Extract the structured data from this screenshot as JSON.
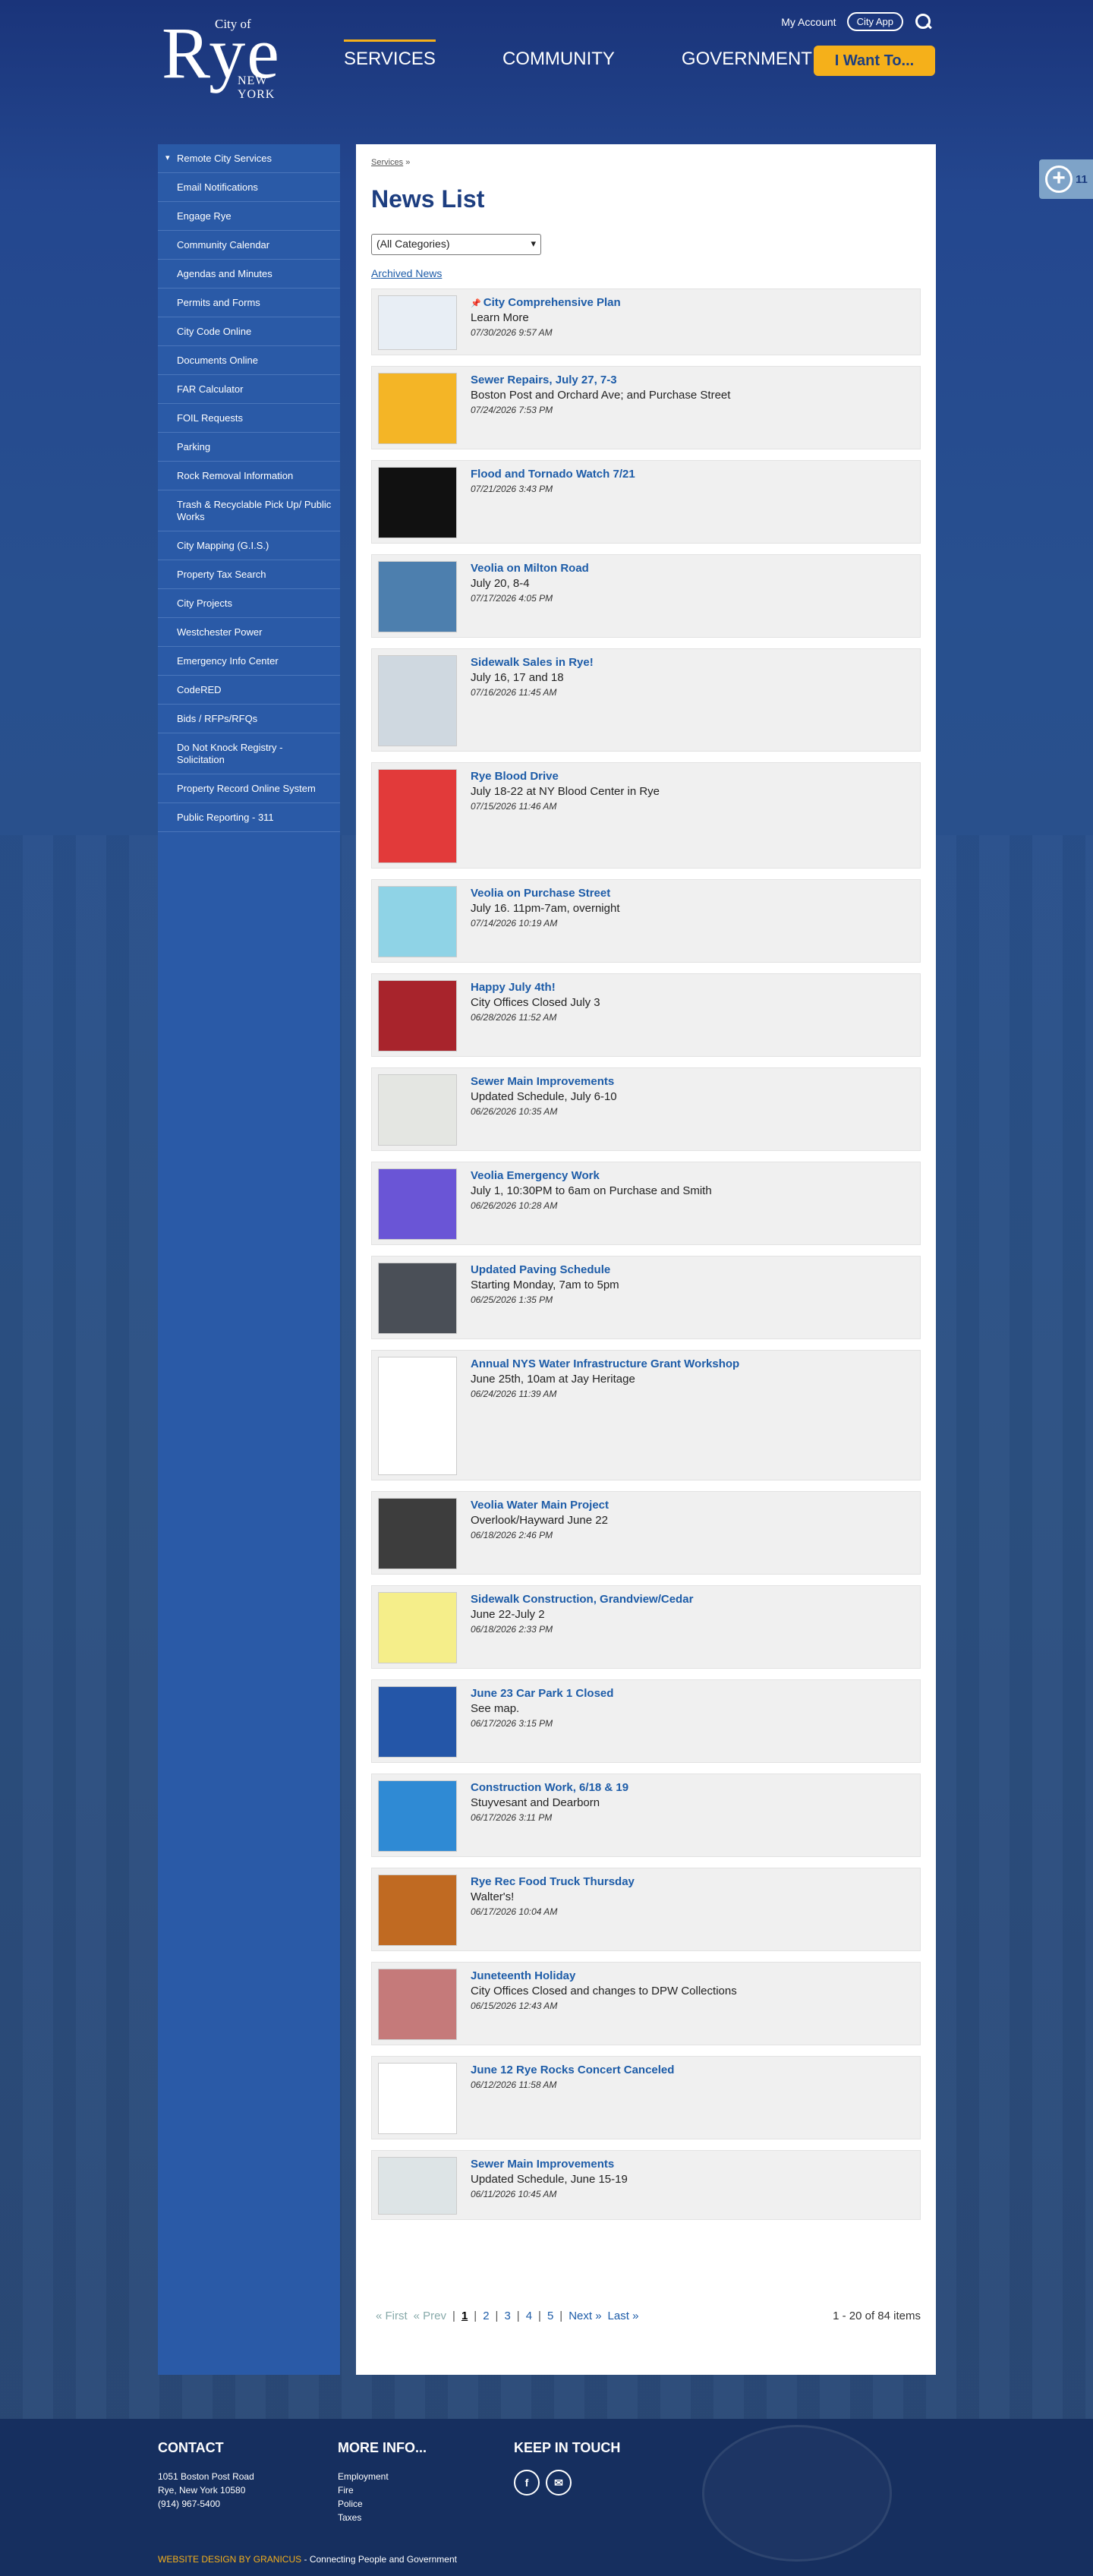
{
  "header": {
    "logo": {
      "city_of": "City of",
      "name": "Rye",
      "state": "NEW YORK"
    },
    "my_account": "My Account",
    "city_app": "City App",
    "nav": [
      "SERVICES",
      "COMMUNITY",
      "GOVERNMENT"
    ],
    "i_want_to": "I Want To...",
    "side_tab_number": "11"
  },
  "sidebar": {
    "items": [
      "Remote City Services",
      "Email Notifications",
      "Engage Rye",
      "Community Calendar",
      "Agendas and Minutes",
      "Permits and Forms",
      "City Code Online",
      "Documents Online",
      "FAR Calculator",
      "FOIL Requests",
      "Parking",
      "Rock Removal Information",
      "Trash & Recyclable Pick Up/ Public Works",
      "City Mapping (G.I.S.)",
      "Property Tax Search",
      "City Projects",
      "Westchester Power",
      "Emergency Info Center",
      "CodeRED",
      "Bids / RFPs/RFQs",
      "Do Not Knock Registry - Solicitation",
      "Property Record Online System",
      "Public Reporting - 311"
    ]
  },
  "main": {
    "breadcrumb": "Services",
    "breadcrumb_sep": "»",
    "title": "News List",
    "category_select": "(All Categories)",
    "archived": "Archived News",
    "news": [
      {
        "title": "City Comprehensive Plan",
        "desc": "Learn More",
        "date": "07/30/2026 9:57 AM",
        "pinned": true,
        "color": "#e8eef5"
      },
      {
        "title": "Sewer Repairs, July 27, 7-3",
        "desc": "Boston Post and Orchard Ave; and Purchase Street",
        "date": "07/24/2026 7:53 PM",
        "color": "#f4b526"
      },
      {
        "title": "Flood and Tornado Watch 7/21",
        "desc": "",
        "date": "07/21/2026 3:43 PM",
        "color": "#111111"
      },
      {
        "title": "Veolia on Milton Road",
        "desc": "July 20, 8-4",
        "date": "07/17/2026 4:05 PM",
        "color": "#4d7fae"
      },
      {
        "title": "Sidewalk Sales in Rye!",
        "desc": "July 16, 17 and 18",
        "date": "07/16/2026 11:45 AM",
        "color": "#cfd8e0"
      },
      {
        "title": "Rye Blood Drive",
        "desc": "July 18-22 at NY Blood Center in Rye",
        "date": "07/15/2026 11:46 AM",
        "color": "#e23a3a"
      },
      {
        "title": "Veolia on Purchase Street",
        "desc": "July 16. 11pm-7am, overnight",
        "date": "07/14/2026 10:19 AM",
        "color": "#8fd3e6"
      },
      {
        "title": "Happy July 4th!",
        "desc": "City Offices Closed July 3",
        "date": "06/28/2026 11:52 AM",
        "color": "#a8242c"
      },
      {
        "title": "Sewer Main Improvements",
        "desc": "Updated Schedule, July 6-10",
        "date": "06/26/2026 10:35 AM",
        "color": "#e4e6e2"
      },
      {
        "title": "Veolia Emergency Work",
        "desc": "July 1, 10:30PM to 6am on Purchase and Smith",
        "date": "06/26/2026 10:28 AM",
        "color": "#6a55d6"
      },
      {
        "title": "Updated Paving Schedule",
        "desc": "Starting Monday, 7am to 5pm",
        "date": "06/25/2026 1:35 PM",
        "color": "#4a4f57"
      },
      {
        "title": "Annual NYS Water Infrastructure Grant Workshop",
        "desc": "June 25th, 10am at Jay Heritage",
        "date": "06/24/2026 11:39 AM",
        "color": "#ffffff"
      },
      {
        "title": "Veolia Water Main Project",
        "desc": "Overlook/Hayward June 22",
        "date": "06/18/2026 2:46 PM",
        "color": "#3d3d3d"
      },
      {
        "title": "Sidewalk Construction, Grandview/Cedar",
        "desc": "June 22-July 2",
        "date": "06/18/2026 2:33 PM",
        "color": "#f5ee8a"
      },
      {
        "title": "June 23 Car Park 1 Closed",
        "desc": "See map.",
        "date": "06/17/2026 3:15 PM",
        "color": "#2456a8"
      },
      {
        "title": "Construction Work, 6/18 & 19",
        "desc": "Stuyvesant and Dearborn",
        "date": "06/17/2026 3:11 PM",
        "color": "#2f8ad4"
      },
      {
        "title": "Rye Rec Food Truck Thursday",
        "desc": "Walter's!",
        "date": "06/17/2026 10:04 AM",
        "color": "#c06a22"
      },
      {
        "title": "Juneteenth Holiday",
        "desc": "City Offices Closed and changes to DPW Collections",
        "date": "06/15/2026 12:43 AM",
        "color": "#c57a7a"
      },
      {
        "title": "June 12 Rye Rocks Concert Canceled",
        "desc": "",
        "date": "06/12/2026 11:58 AM",
        "color": "#ffffff"
      },
      {
        "title": "Sewer Main Improvements",
        "desc": "Updated Schedule, June 15-19",
        "date": "06/11/2026 10:45 AM",
        "color": "#dde4e6"
      }
    ],
    "pager": {
      "first": "« First",
      "prev": "« Prev",
      "pages": [
        "1",
        "2",
        "3",
        "4",
        "5"
      ],
      "next": "Next »",
      "last": "Last »",
      "count": "1 - 20 of 84 items"
    }
  },
  "footer": {
    "contact_title": "CONTACT",
    "address1": "1051 Boston Post Road",
    "address2": "Rye, New York 10580",
    "phone": "(914) 967-5400",
    "more_title": "MORE INFO...",
    "more_links": [
      "Employment",
      "Fire",
      "Police",
      "Taxes"
    ],
    "keep_title": "KEEP IN TOUCH",
    "social": [
      "facebook-icon",
      "email-icon"
    ],
    "credit_label": "WEBSITE DESIGN BY GRANICUS",
    "credit_rest": " - Connecting People and Government"
  }
}
